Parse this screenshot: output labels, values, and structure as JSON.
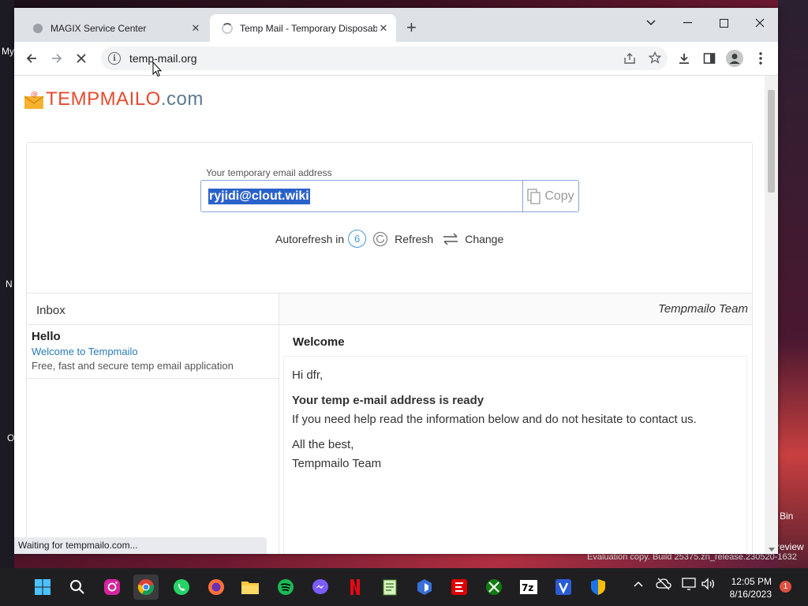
{
  "desktop": {
    "labels": [
      "My",
      "N",
      "O",
      "Bin",
      "review"
    ],
    "watermark": "Evaluation copy. Build 25375.zn_release.230520-1632"
  },
  "browser": {
    "tabs": [
      {
        "title": "MAGIX Service Center",
        "state": "inactive"
      },
      {
        "title": "Temp Mail - Temporary Disposab",
        "state": "active-loading"
      }
    ],
    "url": "temp-mail.org",
    "status_text": "Waiting for tempmailo.com..."
  },
  "page": {
    "logo": {
      "part1": "TEMPMAILO",
      "part2": ".com",
      "color1": "#e64a2e",
      "color2": "#5c7a8c"
    },
    "email_label": "Your temporary email address",
    "email_value": "ryjidi@clout.wiki",
    "copy_label": "Copy",
    "autorefresh_label": "Autorefresh in",
    "autorefresh_count": "6",
    "refresh_label": "Refresh",
    "change_label": "Change",
    "inbox_title": "Inbox",
    "sender_header": "Tempmailo Team",
    "inbox_items": [
      {
        "sender": "Hello",
        "subject": "Welcome to Tempmailo",
        "preview": "Free, fast and secure temp email application"
      }
    ],
    "message": {
      "subject": "Welcome",
      "greeting": "Hi dfr,",
      "headline": "Your temp e-mail address is ready",
      "line1": "If you need help read the information below and do not hesitate to contact us.",
      "signoff": "All the best,",
      "signature": "Tempmailo Team"
    }
  },
  "taskbar": {
    "apps": [
      "windows-start",
      "search",
      "instagram",
      "chrome",
      "whatsapp",
      "firefox",
      "file-explorer",
      "spotify",
      "messenger",
      "netflix",
      "notepad",
      "app",
      "espn",
      "xbox",
      "7zip",
      "v-app",
      "defender"
    ],
    "time": "12:05 PM",
    "date": "8/16/2023",
    "notification_count": "1"
  }
}
